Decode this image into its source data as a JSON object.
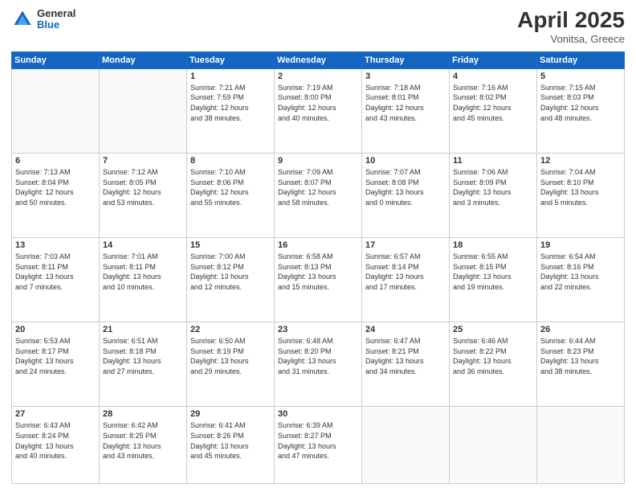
{
  "header": {
    "logo_general": "General",
    "logo_blue": "Blue",
    "title": "April 2025",
    "location": "Vonitsa, Greece"
  },
  "weekdays": [
    "Sunday",
    "Monday",
    "Tuesday",
    "Wednesday",
    "Thursday",
    "Friday",
    "Saturday"
  ],
  "weeks": [
    [
      {
        "day": "",
        "info": ""
      },
      {
        "day": "",
        "info": ""
      },
      {
        "day": "1",
        "info": "Sunrise: 7:21 AM\nSunset: 7:59 PM\nDaylight: 12 hours\nand 38 minutes."
      },
      {
        "day": "2",
        "info": "Sunrise: 7:19 AM\nSunset: 8:00 PM\nDaylight: 12 hours\nand 40 minutes."
      },
      {
        "day": "3",
        "info": "Sunrise: 7:18 AM\nSunset: 8:01 PM\nDaylight: 12 hours\nand 43 minutes."
      },
      {
        "day": "4",
        "info": "Sunrise: 7:16 AM\nSunset: 8:02 PM\nDaylight: 12 hours\nand 45 minutes."
      },
      {
        "day": "5",
        "info": "Sunrise: 7:15 AM\nSunset: 8:03 PM\nDaylight: 12 hours\nand 48 minutes."
      }
    ],
    [
      {
        "day": "6",
        "info": "Sunrise: 7:13 AM\nSunset: 8:04 PM\nDaylight: 12 hours\nand 50 minutes."
      },
      {
        "day": "7",
        "info": "Sunrise: 7:12 AM\nSunset: 8:05 PM\nDaylight: 12 hours\nand 53 minutes."
      },
      {
        "day": "8",
        "info": "Sunrise: 7:10 AM\nSunset: 8:06 PM\nDaylight: 12 hours\nand 55 minutes."
      },
      {
        "day": "9",
        "info": "Sunrise: 7:09 AM\nSunset: 8:07 PM\nDaylight: 12 hours\nand 58 minutes."
      },
      {
        "day": "10",
        "info": "Sunrise: 7:07 AM\nSunset: 8:08 PM\nDaylight: 13 hours\nand 0 minutes."
      },
      {
        "day": "11",
        "info": "Sunrise: 7:06 AM\nSunset: 8:09 PM\nDaylight: 13 hours\nand 3 minutes."
      },
      {
        "day": "12",
        "info": "Sunrise: 7:04 AM\nSunset: 8:10 PM\nDaylight: 13 hours\nand 5 minutes."
      }
    ],
    [
      {
        "day": "13",
        "info": "Sunrise: 7:03 AM\nSunset: 8:11 PM\nDaylight: 13 hours\nand 7 minutes."
      },
      {
        "day": "14",
        "info": "Sunrise: 7:01 AM\nSunset: 8:11 PM\nDaylight: 13 hours\nand 10 minutes."
      },
      {
        "day": "15",
        "info": "Sunrise: 7:00 AM\nSunset: 8:12 PM\nDaylight: 13 hours\nand 12 minutes."
      },
      {
        "day": "16",
        "info": "Sunrise: 6:58 AM\nSunset: 8:13 PM\nDaylight: 13 hours\nand 15 minutes."
      },
      {
        "day": "17",
        "info": "Sunrise: 6:57 AM\nSunset: 8:14 PM\nDaylight: 13 hours\nand 17 minutes."
      },
      {
        "day": "18",
        "info": "Sunrise: 6:55 AM\nSunset: 8:15 PM\nDaylight: 13 hours\nand 19 minutes."
      },
      {
        "day": "19",
        "info": "Sunrise: 6:54 AM\nSunset: 8:16 PM\nDaylight: 13 hours\nand 22 minutes."
      }
    ],
    [
      {
        "day": "20",
        "info": "Sunrise: 6:53 AM\nSunset: 8:17 PM\nDaylight: 13 hours\nand 24 minutes."
      },
      {
        "day": "21",
        "info": "Sunrise: 6:51 AM\nSunset: 8:18 PM\nDaylight: 13 hours\nand 27 minutes."
      },
      {
        "day": "22",
        "info": "Sunrise: 6:50 AM\nSunset: 8:19 PM\nDaylight: 13 hours\nand 29 minutes."
      },
      {
        "day": "23",
        "info": "Sunrise: 6:48 AM\nSunset: 8:20 PM\nDaylight: 13 hours\nand 31 minutes."
      },
      {
        "day": "24",
        "info": "Sunrise: 6:47 AM\nSunset: 8:21 PM\nDaylight: 13 hours\nand 34 minutes."
      },
      {
        "day": "25",
        "info": "Sunrise: 6:46 AM\nSunset: 8:22 PM\nDaylight: 13 hours\nand 36 minutes."
      },
      {
        "day": "26",
        "info": "Sunrise: 6:44 AM\nSunset: 8:23 PM\nDaylight: 13 hours\nand 38 minutes."
      }
    ],
    [
      {
        "day": "27",
        "info": "Sunrise: 6:43 AM\nSunset: 8:24 PM\nDaylight: 13 hours\nand 40 minutes."
      },
      {
        "day": "28",
        "info": "Sunrise: 6:42 AM\nSunset: 8:25 PM\nDaylight: 13 hours\nand 43 minutes."
      },
      {
        "day": "29",
        "info": "Sunrise: 6:41 AM\nSunset: 8:26 PM\nDaylight: 13 hours\nand 45 minutes."
      },
      {
        "day": "30",
        "info": "Sunrise: 6:39 AM\nSunset: 8:27 PM\nDaylight: 13 hours\nand 47 minutes."
      },
      {
        "day": "",
        "info": ""
      },
      {
        "day": "",
        "info": ""
      },
      {
        "day": "",
        "info": ""
      }
    ]
  ]
}
